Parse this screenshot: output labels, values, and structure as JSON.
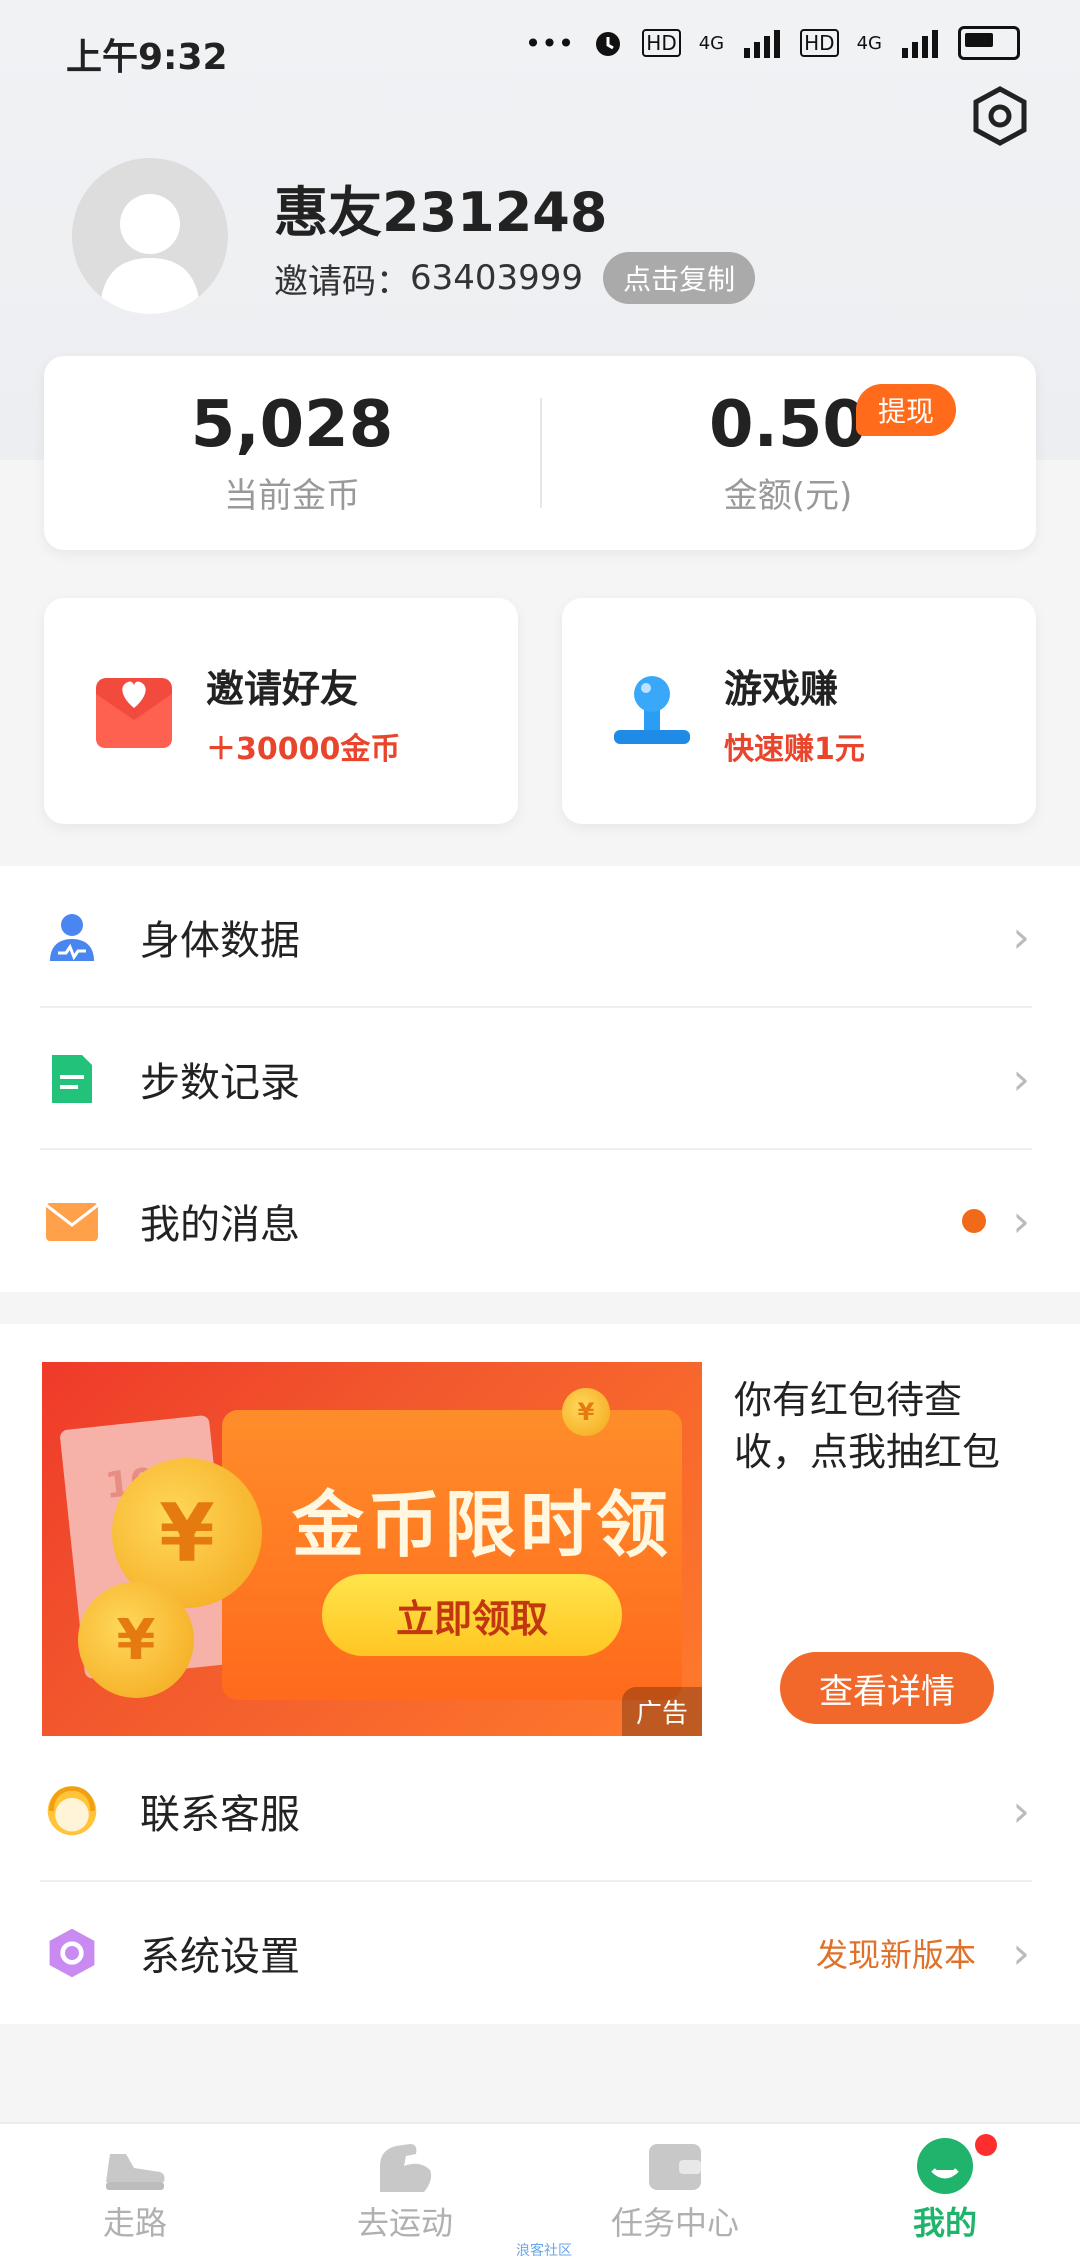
{
  "status_bar": {
    "time": "上午9:32",
    "indicators": [
      "•••",
      "HD",
      "4G",
      "HD",
      "4G"
    ]
  },
  "header": {
    "settings_icon": "hexagon-settings-icon",
    "username": "惠友231248",
    "invite_label": "邀请码：",
    "invite_code": "63403999",
    "copy_button": "点击复制"
  },
  "balance": {
    "coins_value": "5,028",
    "coins_label": "当前金币",
    "amount_value": "0.50",
    "amount_label": "金额(元)",
    "withdraw_label": "提现"
  },
  "features": [
    {
      "title": "邀请好友",
      "subtitle": "＋30000金币",
      "icon": "red-envelope-heart-icon"
    },
    {
      "title": "游戏赚",
      "subtitle": "快速赚1元",
      "icon": "joystick-icon"
    }
  ],
  "menu_top": [
    {
      "label": "身体数据",
      "icon": "body-data-icon"
    },
    {
      "label": "步数记录",
      "icon": "document-icon"
    },
    {
      "label": "我的消息",
      "icon": "mail-icon",
      "has_dot": true
    }
  ],
  "ad": {
    "banner_title": "金币限时领",
    "banner_button": "立即领取",
    "banner_tag": "广告",
    "coin_symbol": "¥",
    "bill_text": "100",
    "text": "你有红包待查收，点我抽红包",
    "detail_button": "查看详情"
  },
  "menu_bottom": [
    {
      "label": "联系客服",
      "icon": "customer-service-icon"
    },
    {
      "label": "系统设置",
      "icon": "system-settings-icon",
      "extra": "发现新版本"
    }
  ],
  "bottom_nav": [
    {
      "label": "走路",
      "icon": "sneaker-icon"
    },
    {
      "label": "去运动",
      "icon": "muscle-arm-icon"
    },
    {
      "label": "任务中心",
      "icon": "wallet-icon"
    },
    {
      "label": "我的",
      "icon": "profile-face-icon",
      "active": true
    }
  ],
  "watermark": "浪客社区",
  "colors": {
    "accent_green": "#1fb36b",
    "accent_orange": "#f2682a",
    "accent_red": "#e8452c"
  }
}
